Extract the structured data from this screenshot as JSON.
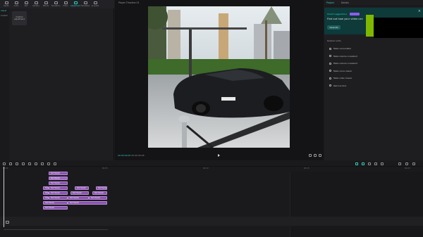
{
  "media_toolbar": {
    "items": [
      {
        "label": "Media",
        "icon": "media-icon",
        "active": false
      },
      {
        "label": "Audio",
        "icon": "audio-icon",
        "active": false
      },
      {
        "label": "Text",
        "icon": "text-icon",
        "active": false
      },
      {
        "label": "Stickers",
        "icon": "sticker-icon",
        "active": false
      },
      {
        "label": "Effects",
        "icon": "effects-icon",
        "active": false
      },
      {
        "label": "Transitions",
        "icon": "transitions-icon",
        "active": false
      },
      {
        "label": "Filters",
        "icon": "filters-icon",
        "active": false
      },
      {
        "label": "Adjustment",
        "icon": "adjustment-icon",
        "active": true
      },
      {
        "label": "Templates",
        "icon": "templates-icon",
        "active": false
      },
      {
        "label": "AI avatar",
        "icon": "ai-avatar-icon",
        "active": false
      }
    ]
  },
  "left_panel": {
    "side_items": [
      {
        "label": "Adjust",
        "active": true
      },
      {
        "label": "Custom",
        "active": false
      }
    ],
    "preset_tile": {
      "label": "Custom adjustment"
    }
  },
  "player": {
    "title": "Player Timeline 01",
    "timecode_current": "00:00:00:00",
    "timecode_total": "00:00:09:28"
  },
  "right_panel": {
    "tabs": [
      {
        "label": "Project",
        "active": true
      },
      {
        "label": "Details",
        "active": false
      }
    ],
    "promo": {
      "label": "Smart suggestions",
      "text": "Find out how your video can",
      "button": "Generate"
    },
    "voice_section": {
      "title": "Related edits",
      "items": [
        {
          "label": "Make voice better"
        },
        {
          "label": "Make volume consistent"
        },
        {
          "label": "Make volume consistent"
        },
        {
          "label": "Make voice clearer"
        },
        {
          "label": "Make video clearer"
        },
        {
          "label": "Remove face"
        }
      ]
    }
  },
  "timeline": {
    "ruler_ticks": [
      "00:00",
      "00:05",
      "00:10",
      "00:15",
      "00:20",
      "00:25",
      "00:30"
    ],
    "clips": [
      {
        "label": "Text Header"
      },
      {
        "label": "Text Header"
      },
      {
        "label": "Text Header"
      },
      {
        "label": "Text Header"
      },
      {
        "label": "Text Header"
      },
      {
        "label": "Text Header"
      },
      {
        "label": "Text Header"
      },
      {
        "label": "Text Header"
      },
      {
        "label": "Text Header"
      },
      {
        "label": "Text Header"
      },
      {
        "label": "Text Header"
      },
      {
        "label": "Text Header"
      },
      {
        "label": "Text Header"
      },
      {
        "label": "Text Header"
      },
      {
        "label": "Text Header"
      },
      {
        "label": "Text Header"
      },
      {
        "label": "Text Header"
      },
      {
        "label": "Text Header"
      }
    ]
  },
  "colors": {
    "accent": "#2fd3c7",
    "clip": "#8a53b0",
    "promo_bg": "#0e3a3a",
    "badge": "#8c5cf0",
    "green_block": "#7fb800"
  }
}
